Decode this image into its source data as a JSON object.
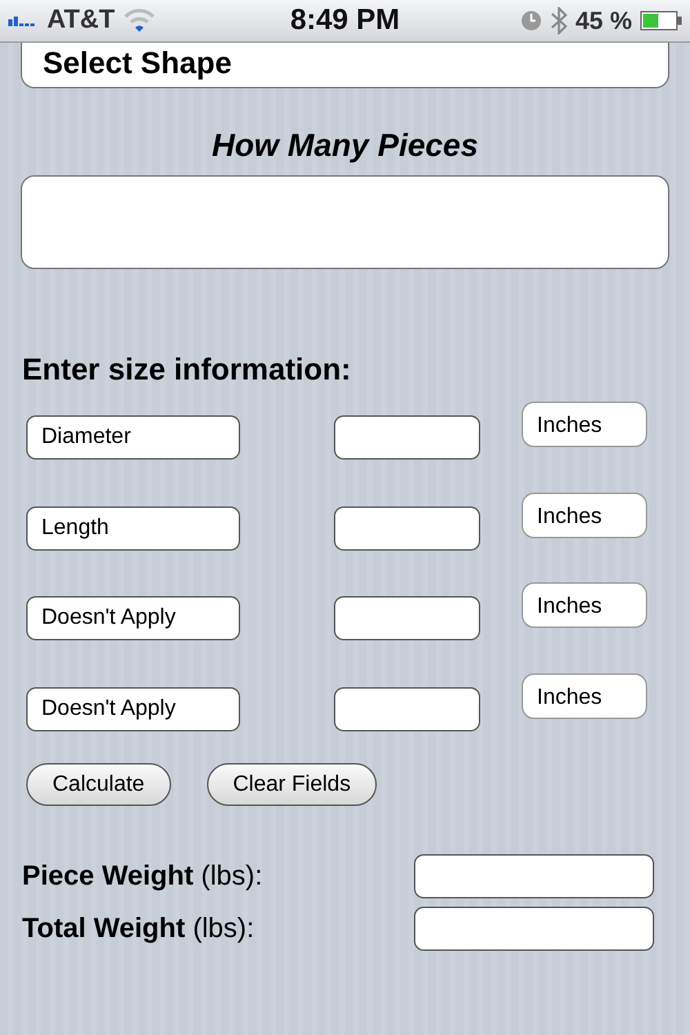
{
  "status_bar": {
    "carrier": "AT&T",
    "time": "8:49 PM",
    "battery": "45 %"
  },
  "shape_select": {
    "value": "Select Shape"
  },
  "pieces": {
    "label": "How Many Pieces"
  },
  "size": {
    "heading": "Enter size information:",
    "rows": [
      {
        "dimension": "Diameter",
        "unit": "Inches"
      },
      {
        "dimension": "Length",
        "unit": "Inches"
      },
      {
        "dimension": "Doesn't Apply",
        "unit": "Inches"
      },
      {
        "dimension": "Doesn't Apply",
        "unit": "Inches"
      }
    ]
  },
  "buttons": [
    "Calculate",
    "Clear Fields"
  ],
  "results": [
    {
      "label": "**Piece Weight** (lbs):"
    },
    {
      "label": "**Total Weight** (lbs):"
    }
  ]
}
